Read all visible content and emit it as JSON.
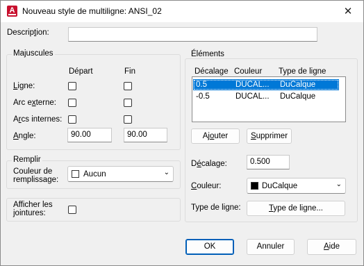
{
  "window": {
    "title": "Nouveau style de multiligne: ANSI_02",
    "app_icon_letter": "A",
    "close_glyph": "✕"
  },
  "description": {
    "label": "Description:",
    "value": ""
  },
  "caps": {
    "group_title": "Majuscules",
    "col_start": "Départ",
    "col_end": "Fin",
    "line_label": "Ligne:",
    "outer_arc_label": "Arc externe:",
    "inner_arcs_label": "Arcs internes:",
    "angle_label": "Angle:",
    "angle_start": "90.00",
    "angle_end": "90.00",
    "line_start_checked": false,
    "line_end_checked": false,
    "outer_start_checked": false,
    "outer_end_checked": false,
    "inner_start_checked": false,
    "inner_end_checked": false
  },
  "fill": {
    "group_title": "Remplir",
    "label_line1": "Couleur de",
    "label_line2": "remplissage:",
    "value": "Aucun"
  },
  "joints": {
    "label_line1": "Afficher les",
    "label_line2": "jointures:",
    "checked": false
  },
  "elements": {
    "group_title": "Éléments",
    "columns": [
      "Décalage",
      "Couleur",
      "Type de ligne"
    ],
    "rows": [
      {
        "offset": "0.5",
        "color": "DUCAL...",
        "linetype": "DuCalque",
        "selected": true
      },
      {
        "offset": "-0.5",
        "color": "DUCAL...",
        "linetype": "DuCalque",
        "selected": false
      }
    ],
    "add_label": "Ajouter",
    "delete_label": "Supprimer",
    "offset_label": "Décalage:",
    "offset_value": "0.500",
    "color_label": "Couleur:",
    "color_value": "DuCalque",
    "color_swatch": "#000000",
    "linetype_label": "Type de ligne:",
    "linetype_button": "Type de ligne..."
  },
  "footer": {
    "ok_label": "OK",
    "cancel_label": "Annuler",
    "help_label": "Aide"
  },
  "colors": {
    "selection": "#0078d7",
    "app_icon": "#c8102e",
    "default_button_border": "#005fb8"
  }
}
